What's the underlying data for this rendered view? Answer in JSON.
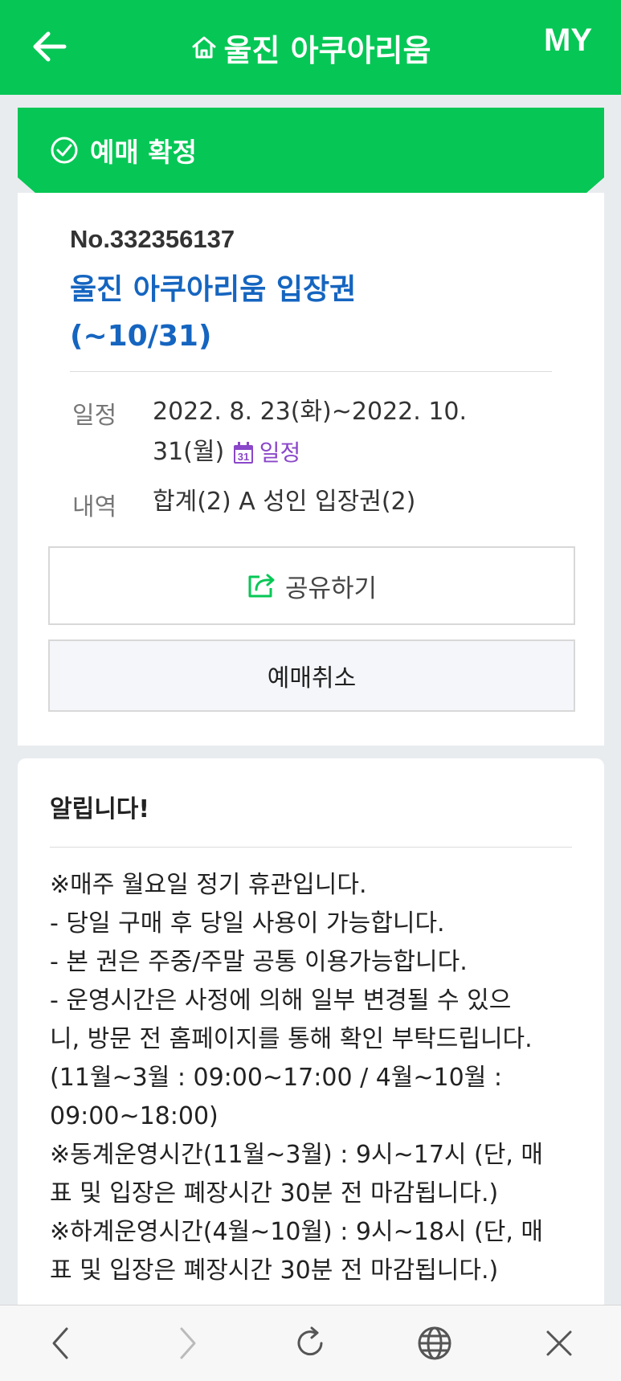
{
  "header": {
    "back_icon": "arrow-left-icon",
    "home_icon": "home-icon",
    "title": "울진 아쿠아리움",
    "my_label": "MY"
  },
  "status_banner": {
    "icon": "check-circle-icon",
    "label": "예매 확정"
  },
  "booking": {
    "number": "No.332356137",
    "product_line1": "울진 아쿠아리움 입장권",
    "product_line2": "(~10/31)",
    "schedule_label": "일정",
    "schedule_line1": "2022. 8. 23(화)~2022. 10.",
    "schedule_line2": "31(월)",
    "calendar_icon": "calendar-icon",
    "calendar_link": "일정",
    "calendar_day": "31",
    "details_label": "내역",
    "details_value": "합계(2) A 성인 입장권(2)"
  },
  "actions": {
    "share_icon": "share-icon",
    "share_label": "공유하기",
    "cancel_label": "예매취소"
  },
  "notice": {
    "title": "알립니다!",
    "lines": [
      "※매주 월요일 정기 휴관입니다.",
      "- 당일 구매 후 당일 사용이 가능합니다.",
      "- 본 권은 주중/주말 공통 이용가능합니다.",
      "- 운영시간은 사정에 의해 일부 변경될 수 있으",
      "니, 방문 전 홈페이지를 통해 확인 부탁드립니다.",
      "(11월~3월 : 09:00~17:00 / 4월~10월 :",
      "09:00~18:00)",
      "※동계운영시간(11월~3월) : 9시~17시 (단, 매",
      "표 및 입장은 폐장시간 30분 전 마감됩니다.)",
      "※하계운영시간(4월~10월) : 9시~18시 (단, 매",
      "표 및 입장은 폐장시간 30분 전 마감됩니다.)"
    ]
  },
  "browser_nav": {
    "back_icon": "chevron-left-icon",
    "forward_icon": "chevron-right-icon",
    "reload_icon": "reload-icon",
    "globe_icon": "globe-icon",
    "close_icon": "close-icon"
  },
  "colors": {
    "brand_green": "#06c755",
    "title_blue": "#1565c0",
    "calendar_purple": "#8a47c9"
  }
}
